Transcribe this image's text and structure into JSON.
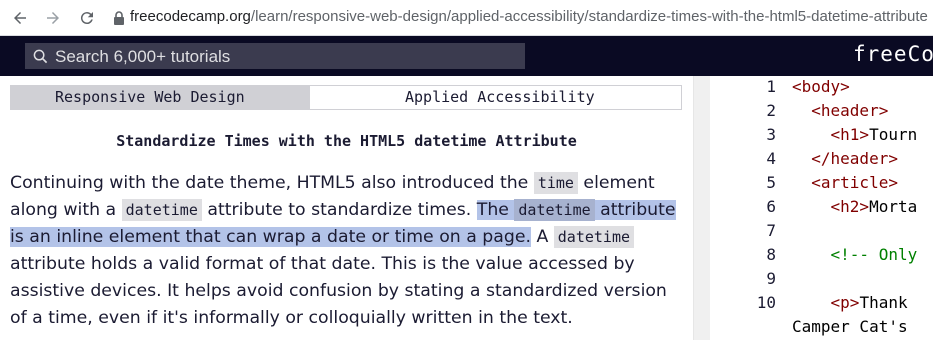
{
  "browser": {
    "url_host": "freecodecamp.org",
    "url_path": "/learn/responsive-web-design/applied-accessibility/standardize-times-with-the-html5-datetime-attribute"
  },
  "nav": {
    "search_placeholder": "Search 6,000+ tutorials",
    "brand": "freeCo"
  },
  "breadcrumb": {
    "superblock": "Responsive Web Design",
    "block": "Applied Accessibility"
  },
  "challenge": {
    "title": "Standardize Times with the HTML5 datetime Attribute",
    "p1": "Continuing with the date theme, HTML5 also introduced the ",
    "code_time": "time",
    "p2": " element along with a ",
    "code_datetime_1": "datetime",
    "p3": " attribute to standardize times. ",
    "hl1": "The ",
    "code_datetime_2": "datetime",
    "hl2": " attribute is an inline element that can wrap a date or time on a page.",
    "p4": " A ",
    "code_datetime_3": "datetime",
    "p5": " attribute holds a valid format of that date. This is the value accessed by assistive devices. It helps avoid confusion by stating a standardized version of a time, even if it's informally or colloquially written in the text."
  },
  "editor": {
    "lines": [
      {
        "num": "1",
        "text": "<body>"
      },
      {
        "num": "2",
        "text": "  <header>"
      },
      {
        "num": "3",
        "text": "    <h1>Tourn"
      },
      {
        "num": "4",
        "text": "  </header>"
      },
      {
        "num": "5",
        "text": "  <article>"
      },
      {
        "num": "6",
        "text": "    <h2>Morta"
      },
      {
        "num": "7",
        "text": ""
      },
      {
        "num": "8",
        "text": "    <!-- Only"
      },
      {
        "num": "9",
        "text": ""
      },
      {
        "num": "10",
        "text": "    <p>Thank"
      }
    ],
    "wrap_line": "Camper Cat's"
  },
  "colors": {
    "nav_bg": "#0a0a23",
    "search_bg": "#3b3b4f",
    "highlight": "#b3c3e8",
    "code_tag": "#800000",
    "code_comment": "#008000"
  }
}
